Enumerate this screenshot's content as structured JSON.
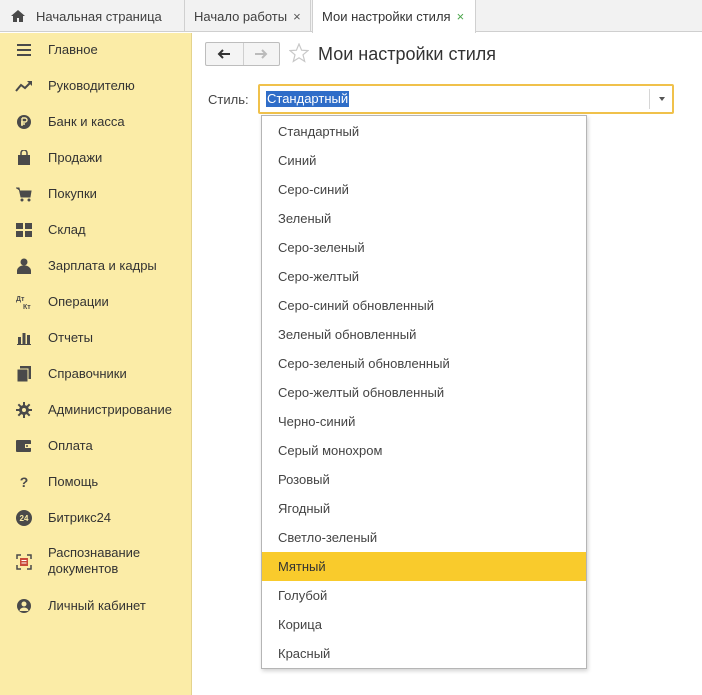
{
  "tabs": {
    "home_label": "Начальная страница",
    "start_label": "Начало работы",
    "active_label": "Мои настройки стиля",
    "close_glyph": "×"
  },
  "sidebar": {
    "items": [
      {
        "label": "Главное",
        "icon": "menu-icon"
      },
      {
        "label": "Руководителю",
        "icon": "trend-icon"
      },
      {
        "label": "Банк и касса",
        "icon": "ruble-icon"
      },
      {
        "label": "Продажи",
        "icon": "shopping-bag-icon"
      },
      {
        "label": "Покупки",
        "icon": "cart-icon"
      },
      {
        "label": "Склад",
        "icon": "grid-icon"
      },
      {
        "label": "Зарплата и кадры",
        "icon": "person-icon"
      },
      {
        "label": "Операции",
        "icon": "debit-credit-icon"
      },
      {
        "label": "Отчеты",
        "icon": "bar-chart-icon"
      },
      {
        "label": "Справочники",
        "icon": "books-icon"
      },
      {
        "label": "Администрирование",
        "icon": "gear-icon"
      },
      {
        "label": "Оплата",
        "icon": "wallet-icon"
      },
      {
        "label": "Помощь",
        "icon": "question-icon"
      },
      {
        "label": "Битрикс24",
        "icon": "bitrix24-icon"
      },
      {
        "label_line1": "Распознавание",
        "label_line2": "документов",
        "icon": "scan-icon"
      },
      {
        "label": "Личный кабинет",
        "icon": "user-circle-icon"
      }
    ],
    "glyphs": {
      "question": "?",
      "b24": "24",
      "dt": "Дт",
      "kt": "Кт"
    }
  },
  "page": {
    "title": "Мои настройки стиля",
    "field_label": "Стиль:",
    "field_value": "Стандартный"
  },
  "dropdown": {
    "options": [
      "Стандартный",
      "Синий",
      "Серо-синий",
      "Зеленый",
      "Серо-зеленый",
      "Серо-желтый",
      "Серо-синий обновленный",
      "Зеленый обновленный",
      "Серо-зеленый обновленный",
      "Серо-желтый обновленный",
      "Черно-синий",
      "Серый монохром",
      "Розовый",
      "Ягодный",
      "Светло-зеленый",
      "Мятный",
      "Голубой",
      "Корица",
      "Красный"
    ],
    "highlighted": "Мятный"
  },
  "colors": {
    "sidebar_bg": "#fbeca7",
    "accent_yellow": "#f9cb2c",
    "selection_blue": "#2f6dc8",
    "close_green": "#4ca64c"
  }
}
